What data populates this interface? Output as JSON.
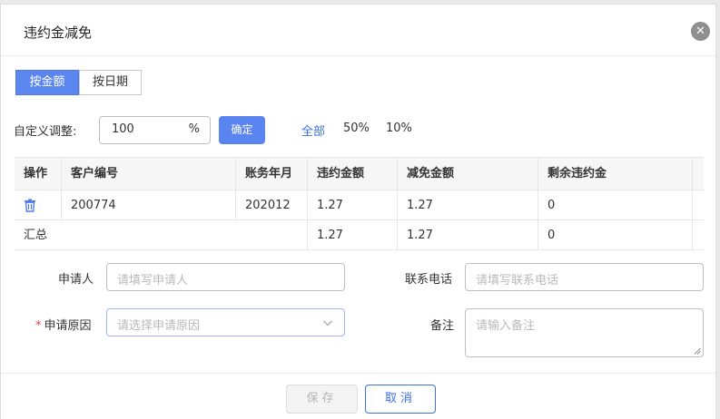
{
  "dialog": {
    "title": "违约金减免",
    "close_icon": "close-icon"
  },
  "mode_tabs": [
    {
      "label": "按金额",
      "active": true
    },
    {
      "label": "按日期",
      "active": false
    }
  ],
  "adjust": {
    "label": "自定义调整:",
    "value": "100",
    "unit": "%",
    "confirm_label": "确定",
    "quick_options": [
      "全部",
      "50%",
      "10%"
    ]
  },
  "table": {
    "headers": [
      "操作",
      "客户编号",
      "账务年月",
      "违约金额",
      "减免金额",
      "剩余违约金"
    ],
    "rows": [
      {
        "action_icon": "trash-icon",
        "customer_no": "200774",
        "period": "202012",
        "penalty": "1.27",
        "relief": "1.27",
        "remaining": "0"
      }
    ],
    "summary": {
      "label": "汇总",
      "penalty": "1.27",
      "relief": "1.27",
      "remaining": "0"
    }
  },
  "form": {
    "applicant_label": "申请人",
    "applicant_placeholder": "请填写申请人",
    "phone_label": "联系电话",
    "phone_placeholder": "请填写联系电话",
    "required_mark": "*",
    "reason_label": "申请原因",
    "reason_placeholder": "请选择申请原因",
    "remark_label": "备注",
    "remark_placeholder": "请输入备注"
  },
  "footer": {
    "save_label": "保存",
    "cancel_label": "取消"
  },
  "colors": {
    "accent": "#5b86f0",
    "link": "#3c6ee3",
    "required": "#e54040"
  }
}
